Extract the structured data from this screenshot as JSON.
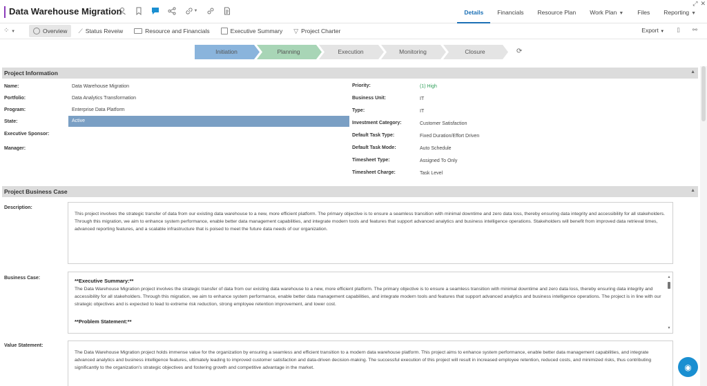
{
  "header": {
    "title": "Data Warehouse Migration",
    "tabs": [
      {
        "label": "Details"
      },
      {
        "label": "Financials"
      },
      {
        "label": "Resource Plan"
      },
      {
        "label": "Work Plan"
      },
      {
        "label": "Files"
      },
      {
        "label": "Reporting"
      }
    ]
  },
  "toolbar": {
    "items": [
      {
        "label": "Overview"
      },
      {
        "label": "Status Reveiw"
      },
      {
        "label": "Resource and Financials"
      },
      {
        "label": "Executive Summary"
      },
      {
        "label": "Project Charter"
      }
    ],
    "export_label": "Export"
  },
  "stages": [
    {
      "label": "Initiation",
      "color": "#8ab4dc"
    },
    {
      "label": "Planning",
      "color": "#a8d5b6"
    },
    {
      "label": "Execution",
      "color": "#e4e4e4"
    },
    {
      "label": "Monitoring",
      "color": "#e4e4e4"
    },
    {
      "label": "Closure",
      "color": "#e4e4e4"
    }
  ],
  "project_info": {
    "title": "Project Information",
    "left": [
      {
        "label": "Name:",
        "value": "Data Warehouse Migration"
      },
      {
        "label": "Portfolio:",
        "value": "Data Analytics Transformation"
      },
      {
        "label": "Program:",
        "value": "Enterprise Data Platform"
      },
      {
        "label": "State:",
        "value": "Active"
      },
      {
        "label": "Executive Sponsor:",
        "value": ""
      },
      {
        "label": "Manager:",
        "value": ""
      }
    ],
    "right": [
      {
        "label": "Priority:",
        "value": "(1) High"
      },
      {
        "label": "Business Unit:",
        "value": "IT"
      },
      {
        "label": "Type:",
        "value": "IT"
      },
      {
        "label": "Investment Category:",
        "value": "Customer Satisfaction"
      },
      {
        "label": "Default Task Type:",
        "value": "Fixed Duration/Effort Driven"
      },
      {
        "label": "Default Task Mode:",
        "value": "Auto Schedule"
      },
      {
        "label": "Timesheet Type:",
        "value": "Assigned To Only"
      },
      {
        "label": "Timesheet Charge:",
        "value": "Task Level"
      }
    ]
  },
  "business_case": {
    "title": "Project Business Case",
    "description_label": "Description:",
    "description": "This project involves the strategic transfer of data from our existing data warehouse to a new, more efficient platform. The primary objective is to ensure a seamless transition with minimal downtime and zero data loss, thereby ensuring data integrity and accessibility for all stakeholders. Through this migration, we aim to enhance system performance, enable better data management capabilities, and integrate modern tools and features that support advanced analytics and business intelligence operations. Stakeholders will benefit from improved data retrieval times, advanced reporting features, and a scalable infrastructure that is poised to meet the future data needs of our organization.",
    "business_case_label": "Business Case:",
    "exec_summary_heading": "**Executive Summary:**",
    "exec_summary": "The Data Warehouse Migration project involves the strategic transfer of data from our existing data warehouse to a new, more efficient platform. The primary objective is to ensure a seamless transition with minimal downtime and zero data loss, thereby ensuring data integrity and accessibility for all stakeholders. Through this migration, we aim to enhance system performance, enable better data management capabilities, and integrate modern tools and features that support advanced analytics and business intelligence operations. The project is in line with our strategic objectives and is expected to lead to extreme risk reduction, strong employee retention improvement, and lower cost.",
    "problem_heading": "**Problem Statement:**",
    "value_label": "Value Statement:",
    "value_statement": "The Data Warehouse Migration project holds immense value for the organization by ensuring a seamless and efficient transition to a modern data warehouse platform. This project aims to enhance system performance, enable better data management capabilities, and integrate advanced analytics and business intelligence features, ultimately leading to improved customer satisfaction and data-driven decision-making. The successful execution of this project will result in increased employee retention, reduced costs, and minimized risks, thus contributing significantly to the organization's strategic objectives and fostering growth and competitive advantage in the market."
  },
  "colors": {
    "accent": "#1a6fb5",
    "state_bg": "#7a9fc4",
    "priority": "#2e9e59"
  }
}
